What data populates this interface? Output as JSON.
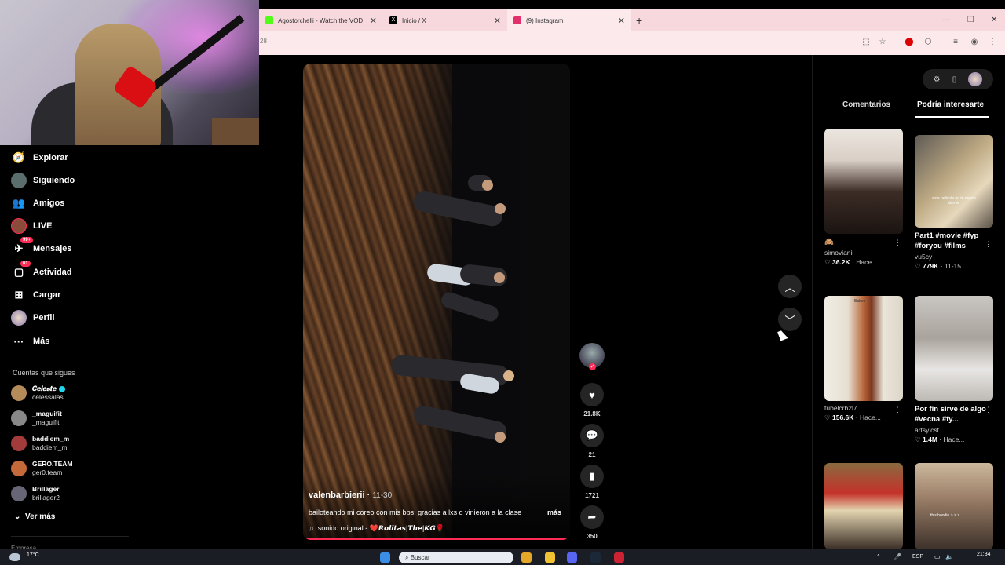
{
  "browser": {
    "tabs": [
      {
        "label": "Agostorchelli - Watch the VOD",
        "favicon_color": "#53fc18"
      },
      {
        "label": "Inicio / X",
        "favicon_color": "#000000"
      },
      {
        "label": "(9) Instagram",
        "favicon_color": "#e1306c"
      }
    ],
    "new_tab_symbol": "+",
    "address_fragment": "28"
  },
  "sidebar": {
    "items": [
      {
        "label": "Explorar",
        "icon": "compass-icon"
      },
      {
        "label": "Siguiendo",
        "icon": "following-avatar-icon"
      },
      {
        "label": "Amigos",
        "icon": "friends-icon"
      },
      {
        "label": "LIVE",
        "icon": "live-avatar-icon"
      },
      {
        "label": "Mensajes",
        "icon": "messages-icon",
        "badge": "99+"
      },
      {
        "label": "Actividad",
        "icon": "activity-icon",
        "badge": "61"
      },
      {
        "label": "Cargar",
        "icon": "upload-icon"
      },
      {
        "label": "Perfil",
        "icon": "profile-avatar-icon"
      },
      {
        "label": "Más",
        "icon": "more-icon"
      }
    ],
    "following_title": "Cuentas que sigues",
    "accounts": [
      {
        "name": "𝑪𝒆𝒍𝒆𝒔𝒕𝒆",
        "username": "celessalas",
        "verified": true,
        "color": "#b58b5a"
      },
      {
        "name": "_maguifit",
        "username": "_maguifit",
        "verified": false,
        "color": "#888888"
      },
      {
        "name": "baddiem_m",
        "username": "baddiem_m",
        "verified": false,
        "color": "#a33b3b"
      },
      {
        "name": "GERO.TEAM",
        "username": "ger0.team",
        "verified": false,
        "color": "#c46a3a"
      },
      {
        "name": "Brillager",
        "username": "brillager2",
        "verified": false,
        "color": "#666677"
      }
    ],
    "see_more": "Ver más",
    "footer_partial": "Empresa"
  },
  "video": {
    "author": "valenbarbierii",
    "date": "11-30",
    "caption": "bailoteando mi coreo con mis bbs; gracias a lxs q vinieron a la clase",
    "more": "más",
    "sound": "sonido original - ❤️𝙍𝙤𝙡𝙞𝙩𝙖𝙨|𝙏𝙝𝙚|𝙆𝙂🌹",
    "progress": 1.0
  },
  "actions": {
    "likes": "21.8K",
    "comments": "21",
    "saves": "1721",
    "shares": "350"
  },
  "right_panel": {
    "tabs": [
      "Comentarios",
      "Podría interesarte"
    ],
    "active_tab": "Podría interesarte",
    "cards": [
      {
        "title": "🙈",
        "user": "simovianii",
        "likes": "36.2K",
        "time": "Hace...",
        "thumb": [
          "#e9e2dc",
          "#3a2a24"
        ]
      },
      {
        "title": "Part1 #movie #fyp #foryou #films",
        "user": "vu5cy",
        "likes": "779K",
        "time": "11-15",
        "thumb": [
          "#6a6660",
          "#d8c7a5"
        ],
        "overlay": "esta pelicula no te dejará dormir"
      },
      {
        "title": "",
        "user": "tubelcrb2l7",
        "likes": "156.6K",
        "time": "Hace...",
        "thumb": [
          "#e7e3da",
          "#b55a2a"
        ],
        "overlay": "Babes"
      },
      {
        "title": "Por fin sirve de algo #vecna #fy...",
        "user": "artsy.cst",
        "likes": "1.4M",
        "time": "Hace...",
        "thumb": [
          "#bdbab6",
          "#5a4f48"
        ]
      },
      {
        "title": "",
        "user": "",
        "likes": "",
        "time": "",
        "thumb": [
          "#8a6a40",
          "#c4322a"
        ]
      },
      {
        "title": "",
        "user": "",
        "likes": "",
        "time": "",
        "thumb": [
          "#c6b49a",
          "#4a3a30"
        ],
        "overlay": "this hoodie > > >"
      }
    ]
  },
  "taskbar": {
    "temp": "17°C",
    "search_placeholder": "Buscar",
    "lang": "ESP",
    "time": "21:34"
  }
}
